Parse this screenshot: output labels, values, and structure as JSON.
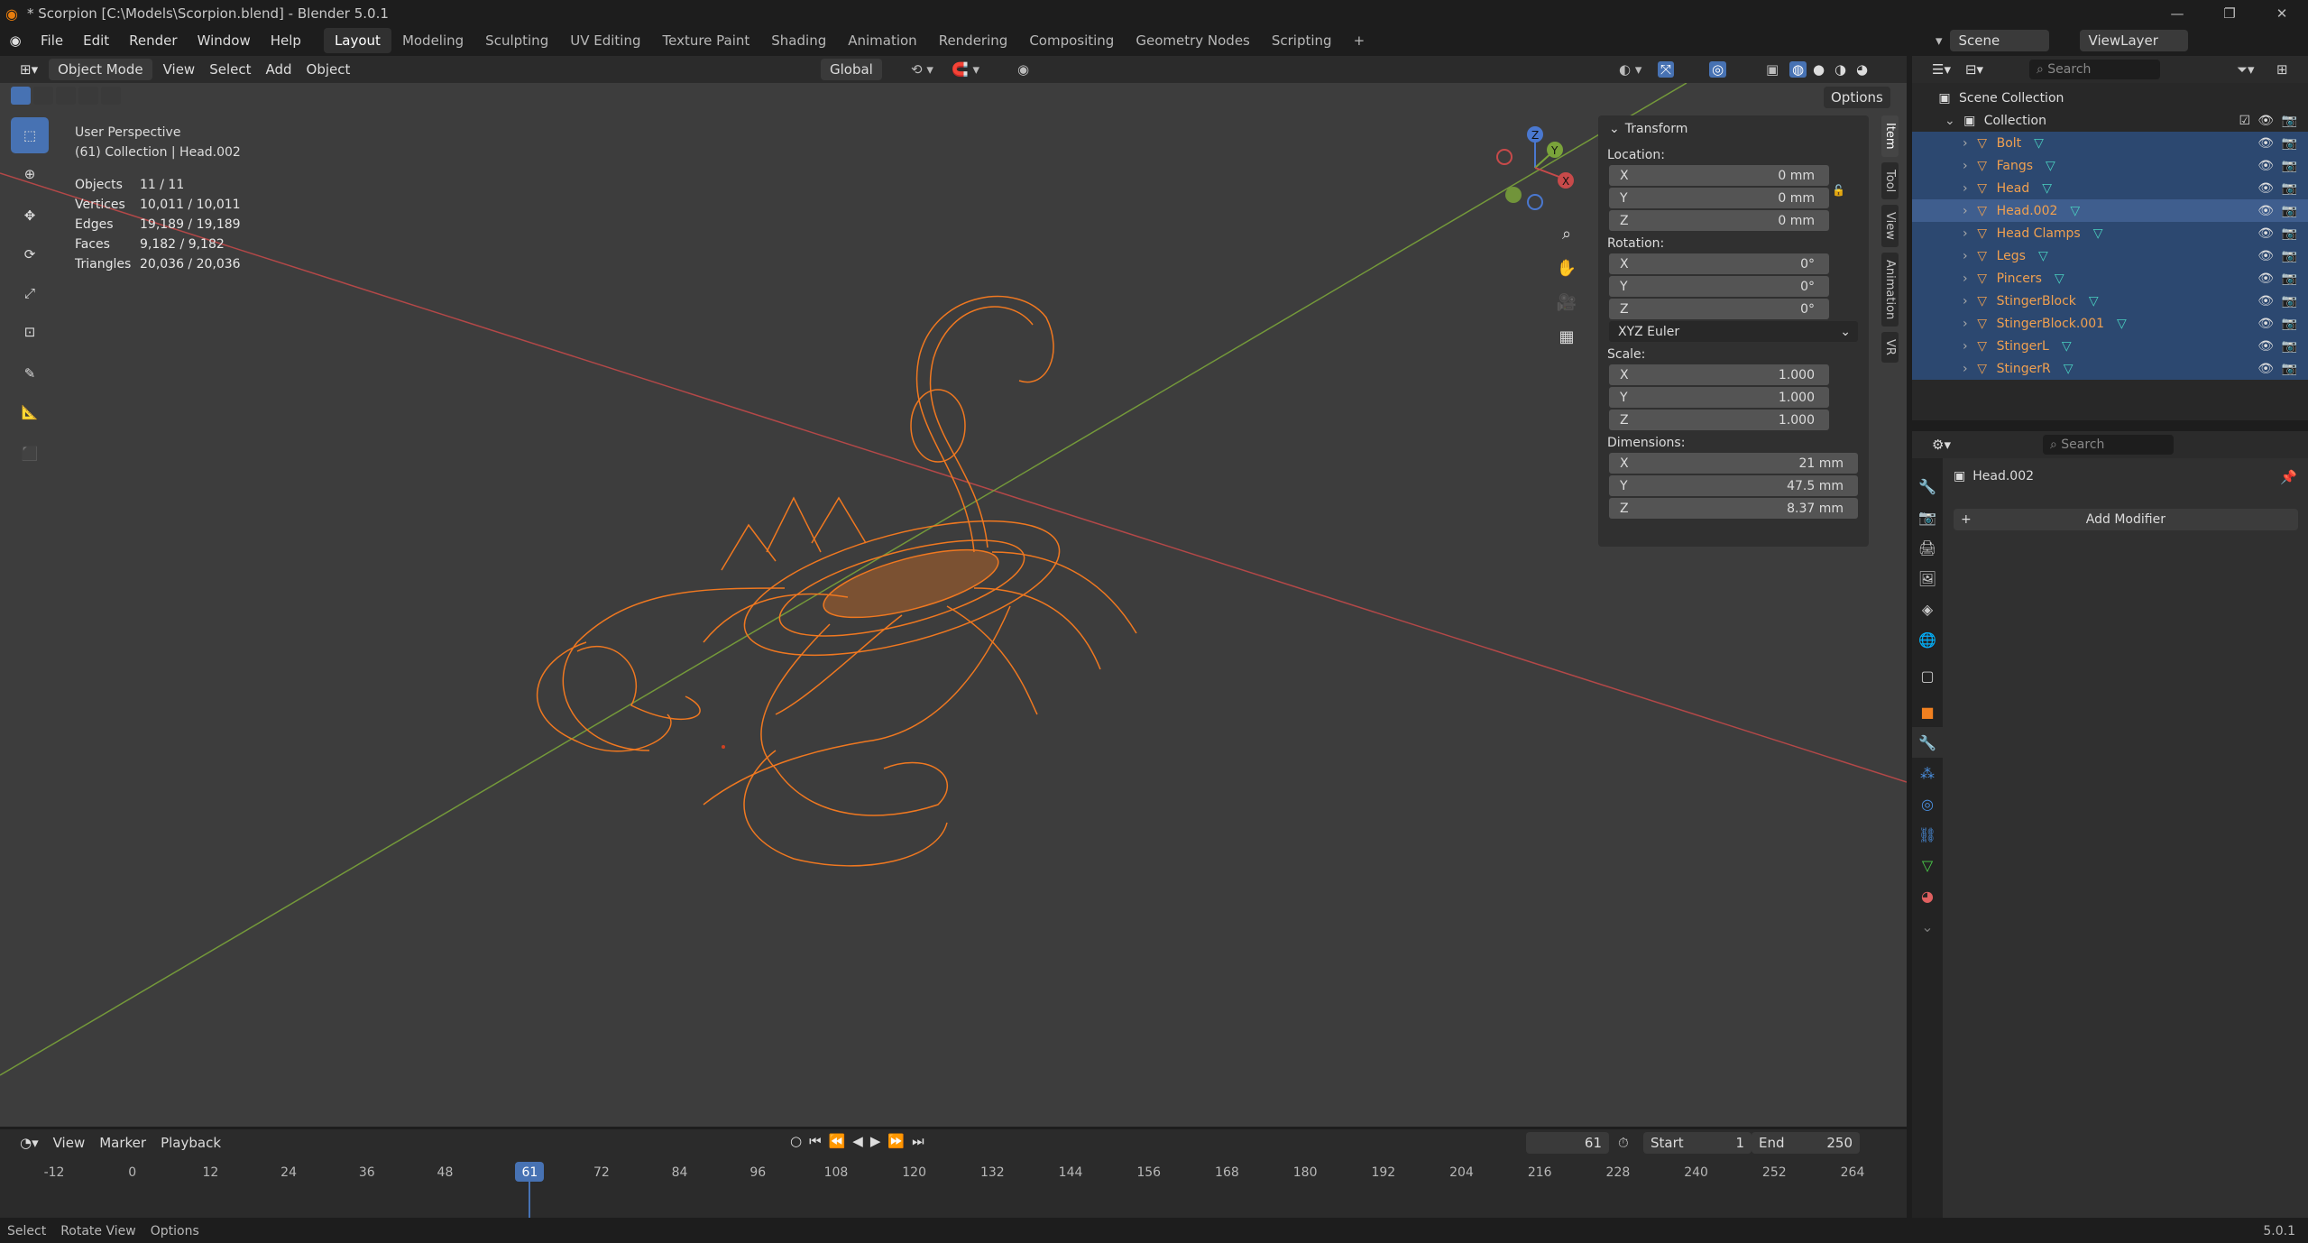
{
  "window": {
    "title": "* Scorpion [C:\\Models\\Scorpion.blend] - Blender 5.0.1",
    "controls": [
      "—",
      "❐",
      "✕"
    ]
  },
  "menu": [
    "File",
    "Edit",
    "Render",
    "Window",
    "Help"
  ],
  "workspaces": [
    "Layout",
    "Modeling",
    "Sculpting",
    "UV Editing",
    "Texture Paint",
    "Shading",
    "Animation",
    "Rendering",
    "Compositing",
    "Geometry Nodes",
    "Scripting",
    "+"
  ],
  "active_workspace": "Layout",
  "scene": {
    "name": "Scene",
    "viewlayer": "ViewLayer"
  },
  "viewport_header": {
    "mode": "Object Mode",
    "menus": [
      "View",
      "Select",
      "Add",
      "Object"
    ],
    "orientation": "Global",
    "options": "Options"
  },
  "overlay_info": {
    "perspective": "User Perspective",
    "collection": "(61) Collection | Head.002",
    "stats": [
      {
        "k": "Objects",
        "v": "11 / 11"
      },
      {
        "k": "Vertices",
        "v": "10,011 / 10,011"
      },
      {
        "k": "Edges",
        "v": "19,189 / 19,189"
      },
      {
        "k": "Faces",
        "v": "9,182 / 9,182"
      },
      {
        "k": "Triangles",
        "v": "20,036 / 20,036"
      }
    ]
  },
  "transform": {
    "title": "Transform",
    "location_label": "Location:",
    "location": [
      {
        "a": "X",
        "v": "0 mm"
      },
      {
        "a": "Y",
        "v": "0 mm"
      },
      {
        "a": "Z",
        "v": "0 mm"
      }
    ],
    "rotation_label": "Rotation:",
    "rotation": [
      {
        "a": "X",
        "v": "0°"
      },
      {
        "a": "Y",
        "v": "0°"
      },
      {
        "a": "Z",
        "v": "0°"
      }
    ],
    "rotation_mode": "XYZ Euler",
    "scale_label": "Scale:",
    "scale": [
      {
        "a": "X",
        "v": "1.000"
      },
      {
        "a": "Y",
        "v": "1.000"
      },
      {
        "a": "Z",
        "v": "1.000"
      }
    ],
    "dimensions_label": "Dimensions:",
    "dimensions": [
      {
        "a": "X",
        "v": "21 mm"
      },
      {
        "a": "Y",
        "v": "47.5 mm"
      },
      {
        "a": "Z",
        "v": "8.37 mm"
      }
    ]
  },
  "side_tabs": [
    "Item",
    "Tool",
    "View",
    "Animation",
    "VR"
  ],
  "gizmo": {
    "z": "Z",
    "y": "Y",
    "x": "X"
  },
  "outliner": {
    "search_placeholder": "Search",
    "scene_collection": "Scene Collection",
    "collection": "Collection",
    "objects": [
      "Bolt",
      "Fangs",
      "Head",
      "Head.002",
      "Head Clamps",
      "Legs",
      "Pincers",
      "StingerBlock",
      "StingerBlock.001",
      "StingerL",
      "StingerR"
    ],
    "active_object": "Head.002"
  },
  "properties": {
    "search_placeholder": "Search",
    "object_name": "Head.002",
    "add_modifier": "Add Modifier"
  },
  "timeline": {
    "menus": [
      "View",
      "Marker",
      "Playback"
    ],
    "current_frame": "61",
    "start_label": "Start",
    "start": "1",
    "end_label": "End",
    "end": "250",
    "ticks": [
      "-12",
      "0",
      "12",
      "24",
      "36",
      "48",
      "61",
      "72",
      "84",
      "96",
      "108",
      "120",
      "132",
      "144",
      "156",
      "168",
      "180",
      "192",
      "204",
      "216",
      "228",
      "240",
      "252",
      "264"
    ]
  },
  "statusbar": {
    "items": [
      "Select",
      "Rotate View",
      "Options"
    ],
    "version": "5.0.1"
  },
  "colors": {
    "accent": "#4772b3",
    "selected": "#f07820",
    "axis_x": "#c84a4a",
    "axis_y": "#7aa33a"
  }
}
